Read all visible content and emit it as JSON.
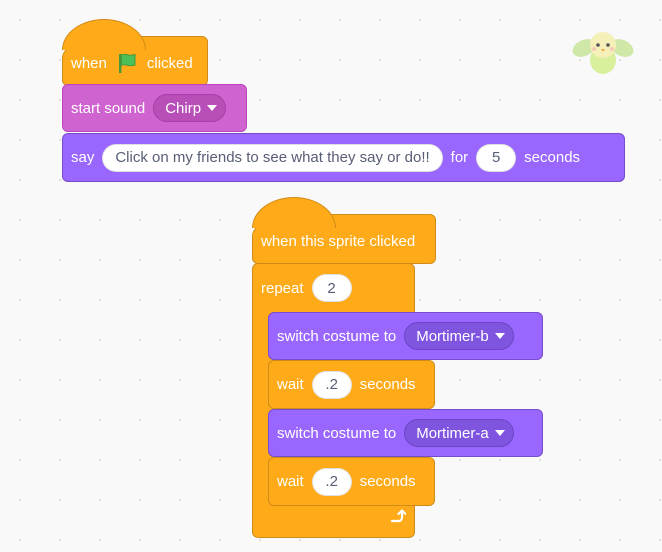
{
  "script1": {
    "hat": {
      "before": "when",
      "after": "clicked",
      "icon": "green-flag-icon"
    },
    "sound": {
      "label": "start sound",
      "value": "Chirp"
    },
    "say": {
      "label": "say",
      "message": "Click on my friends to see what they say or do!!",
      "for_label": "for",
      "seconds_value": "5",
      "seconds_label": "seconds"
    }
  },
  "script2": {
    "hat": {
      "label": "when this sprite clicked"
    },
    "repeat": {
      "label": "repeat",
      "count": "2"
    },
    "body": [
      {
        "type": "costume",
        "label": "switch costume to",
        "value": "Mortimer-b"
      },
      {
        "type": "wait",
        "label": "wait",
        "value": ".2",
        "unit": "seconds"
      },
      {
        "type": "costume",
        "label": "switch costume to",
        "value": "Mortimer-a"
      },
      {
        "type": "wait",
        "label": "wait",
        "value": ".2",
        "unit": "seconds"
      }
    ]
  },
  "sprite": {
    "name": "bird-sprite-thumbnail"
  },
  "colors": {
    "events": "#ffab19",
    "sound": "#cf63cf",
    "looks": "#9966ff",
    "control": "#ffab19",
    "flag": "#4cbf56"
  }
}
